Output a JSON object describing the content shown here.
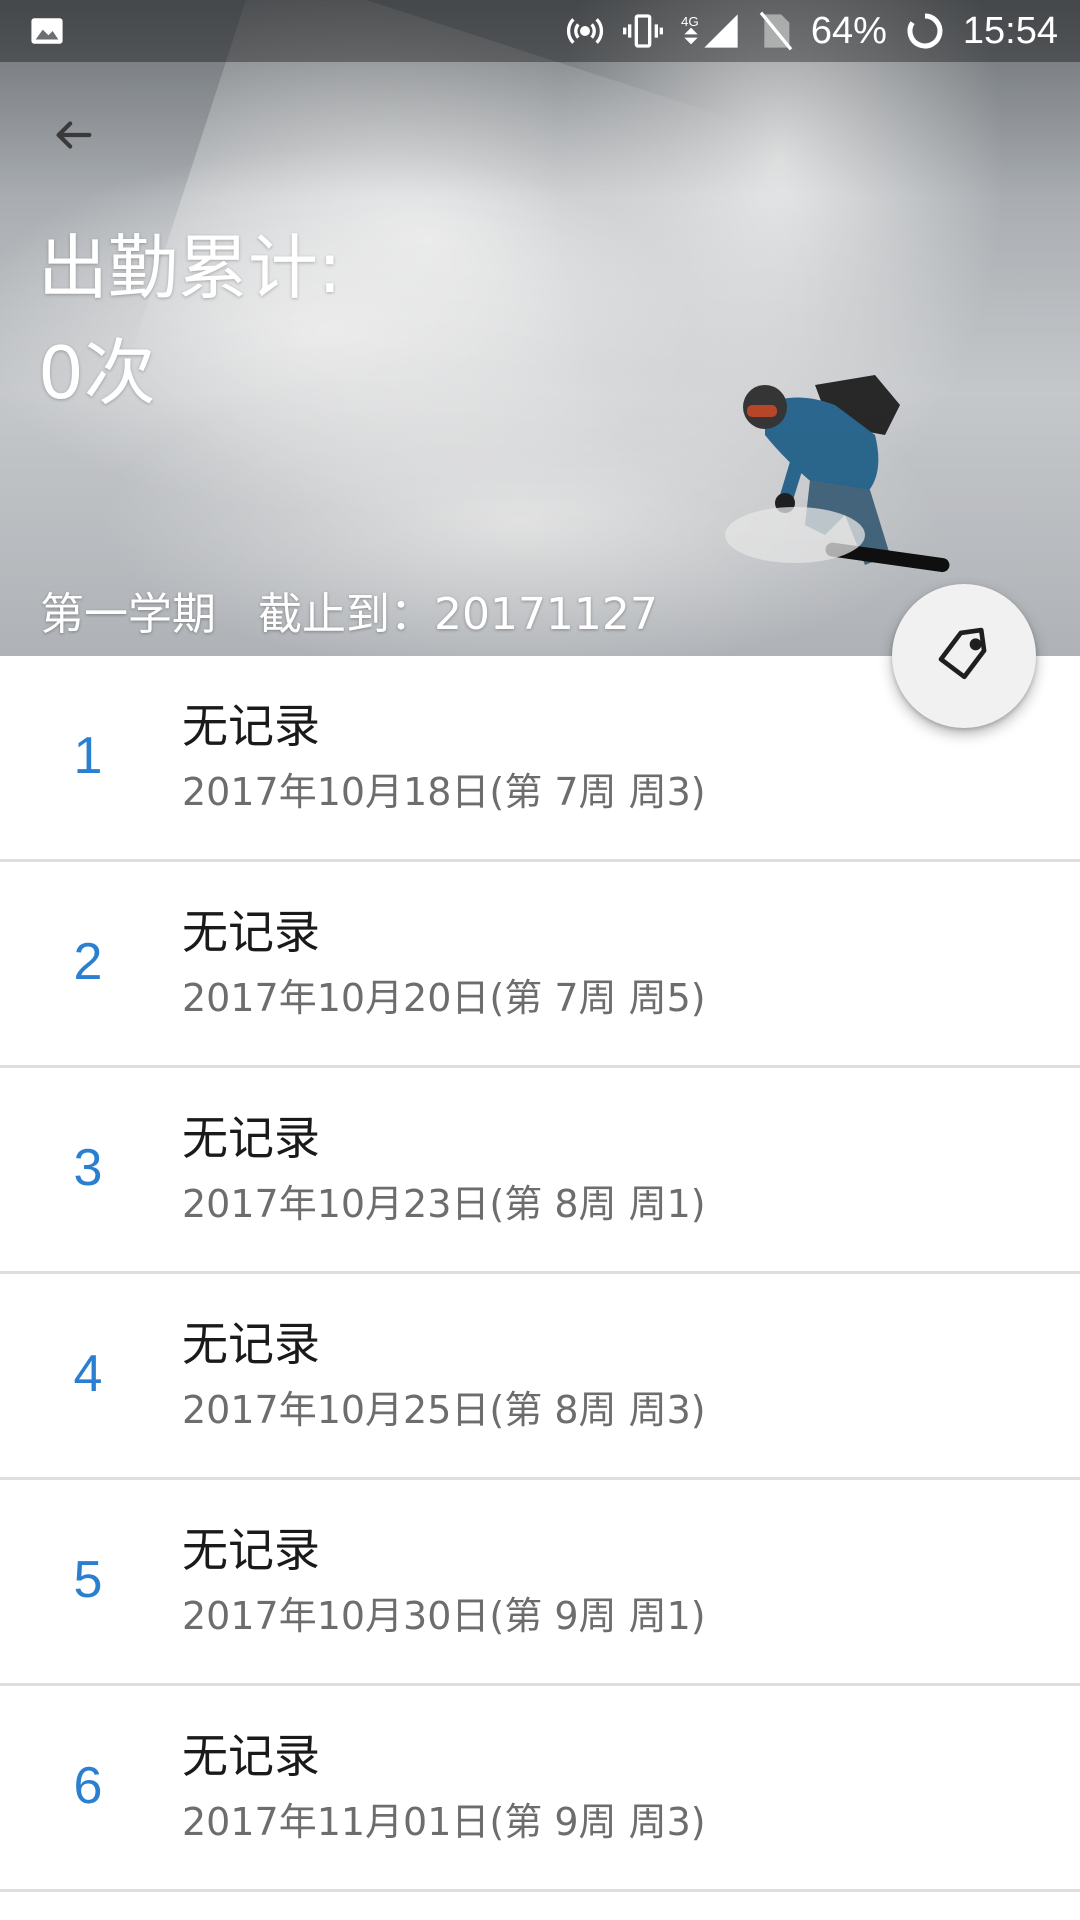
{
  "status_bar": {
    "battery": "64%",
    "time": "15:54",
    "network": "4G",
    "icons": [
      "image-icon",
      "hotspot-icon",
      "vibrate-icon",
      "signal-icon",
      "no-sim-icon",
      "battery-icon"
    ]
  },
  "header": {
    "title": "出勤累计:",
    "count": "0次",
    "subtitle": "第一学期   截止到：20171127"
  },
  "fab": {
    "icon": "tag-icon"
  },
  "records": [
    {
      "index": "1",
      "title": "无记录",
      "date": "2017年10月18日(第 7周 周3)"
    },
    {
      "index": "2",
      "title": "无记录",
      "date": "2017年10月20日(第 7周 周5)"
    },
    {
      "index": "3",
      "title": "无记录",
      "date": "2017年10月23日(第 8周 周1)"
    },
    {
      "index": "4",
      "title": "无记录",
      "date": "2017年10月25日(第 8周 周3)"
    },
    {
      "index": "5",
      "title": "无记录",
      "date": "2017年10月30日(第 9周 周1)"
    },
    {
      "index": "6",
      "title": "无记录",
      "date": "2017年11月01日(第 9周 周3)"
    }
  ],
  "colors": {
    "index_blue": "#2a7fd0",
    "divider": "#dedede",
    "fab_bg": "#f1f1f1"
  }
}
